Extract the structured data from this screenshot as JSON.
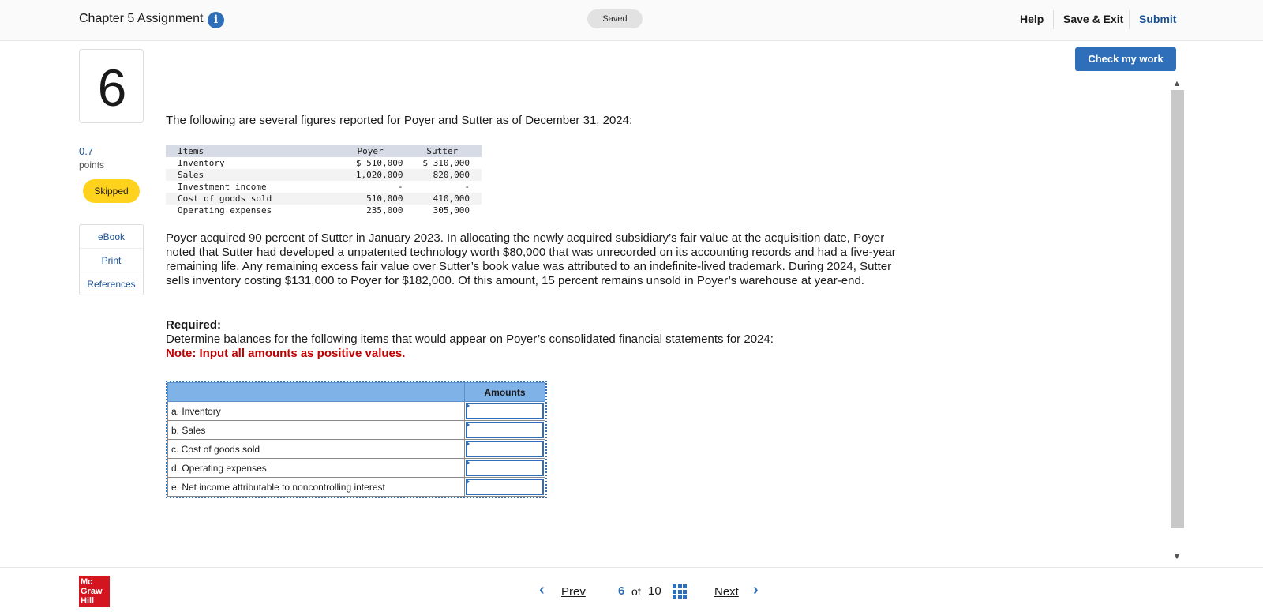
{
  "header": {
    "title": "Chapter 5 Assignment",
    "info_icon": "info-icon",
    "status": "Saved",
    "help": "Help",
    "save_exit": "Save & Exit",
    "submit": "Submit"
  },
  "question": {
    "number": "6",
    "points_value": "0.7",
    "points_label": "points",
    "status_badge": "Skipped",
    "side_links": [
      "eBook",
      "Print",
      "References"
    ],
    "check_button": "Check my work"
  },
  "content": {
    "intro": "The following are several figures reported for Poyer and Sutter as of December 31, 2024:",
    "figures": {
      "headers": [
        "Items",
        "Poyer",
        "Sutter"
      ],
      "rows": [
        [
          "Inventory",
          "$ 510,000",
          "$ 310,000"
        ],
        [
          "Sales",
          "1,020,000",
          "820,000"
        ],
        [
          "Investment income",
          "-",
          "-"
        ],
        [
          "Cost of goods sold",
          "510,000",
          "410,000"
        ],
        [
          "Operating expenses",
          "235,000",
          "305,000"
        ]
      ]
    },
    "paragraph": "Poyer acquired 90 percent of Sutter in January 2023. In allocating the newly acquired subsidiary’s fair value at the acquisition date, Poyer noted that Sutter had developed a unpatented technology worth $80,000 that was unrecorded on its accounting records and had a five-year remaining life. Any remaining excess fair value over Sutter’s book value was attributed to an indefinite-lived trademark. During 2024, Sutter sells inventory costing $131,000 to Poyer for $182,000. Of this amount, 15 percent remains unsold in Poyer’s warehouse at year-end.",
    "required_heading": "Required:",
    "required_text": "Determine balances for the following items that would appear on Poyer’s consolidated financial statements for 2024:",
    "note": "Note: Input all amounts as positive values."
  },
  "answer_table": {
    "column_header": "Amounts",
    "rows": [
      {
        "label": "a. Inventory",
        "value": ""
      },
      {
        "label": "b. Sales",
        "value": ""
      },
      {
        "label": "c. Cost of goods sold",
        "value": ""
      },
      {
        "label": "d. Operating expenses",
        "value": ""
      },
      {
        "label": "e. Net income attributable to noncontrolling interest",
        "value": ""
      }
    ]
  },
  "footer": {
    "logo_text": "Mc Graw Hill",
    "prev": "Prev",
    "page_current": "6",
    "page_of": "of",
    "page_total": "10",
    "next": "Next"
  },
  "colors": {
    "accent": "#2f6fb9",
    "skipped": "#ffd21e",
    "note_red": "#c00000",
    "logo_red": "#d4151f"
  }
}
